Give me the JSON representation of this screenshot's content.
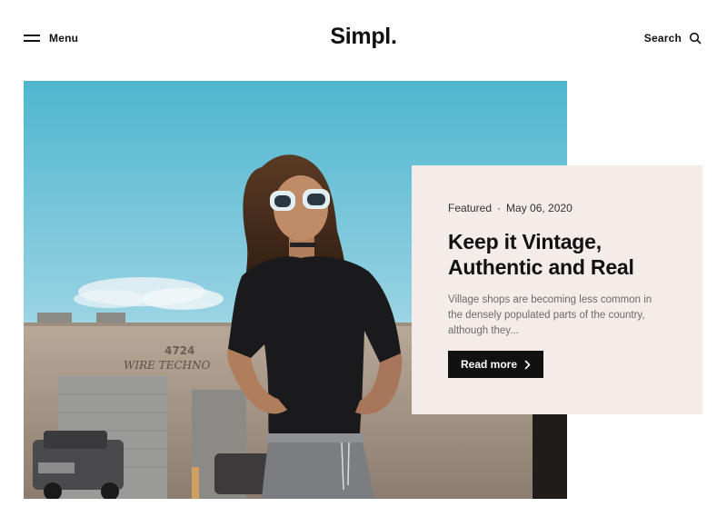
{
  "header": {
    "menu_label": "Menu",
    "logo": "Simpl.",
    "search_label": "Search"
  },
  "featured_post": {
    "category": "Featured",
    "separator": "·",
    "date": "May 06, 2020",
    "title": "Keep it Vintage, Authentic and Real",
    "excerpt": "Village shops are becoming less common in the densely populated parts of the country, although they...",
    "read_more_label": "Read more",
    "building_sign_number": "4724",
    "building_sign_text": "WIRE TECHNO"
  },
  "icons": {
    "menu": "hamburger-icon",
    "search": "search-icon",
    "read_more": "chevron-right-icon"
  },
  "colors": {
    "card_background": "#f4ece8",
    "button_background": "#111111",
    "text": "#111111",
    "muted_text": "#6c6a68",
    "sky": "#7ec8dc"
  }
}
